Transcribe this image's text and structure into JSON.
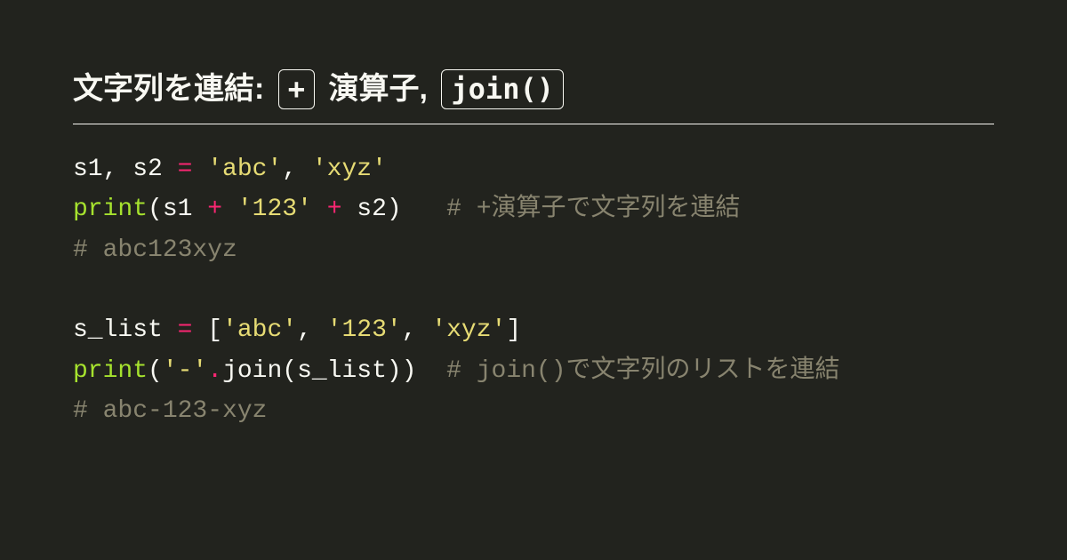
{
  "title": {
    "seg1": "文字列を連結: ",
    "chip1": "+",
    "seg2": " 演算子, ",
    "chip2": "join()"
  },
  "code": {
    "l1": {
      "a": "s1, s2 ",
      "op": "=",
      "b": " ",
      "s1": "'abc'",
      "c": ", ",
      "s2": "'xyz'"
    },
    "l2": {
      "fn": "print",
      "a": "(s1 ",
      "op1": "+",
      "b": " ",
      "s3": "'123'",
      "c": " ",
      "op2": "+",
      "d": " s2)   ",
      "cm": "# +演算子で文字列を連結"
    },
    "l3": {
      "cm": "# abc123xyz"
    },
    "l4": {
      "blank": ""
    },
    "l5": {
      "a": "s_list ",
      "op": "=",
      "b": " [",
      "s1": "'abc'",
      "c": ", ",
      "s2": "'123'",
      "d": ", ",
      "s3": "'xyz'",
      "e": "]"
    },
    "l6": {
      "fn": "print",
      "a": "(",
      "s1": "'-'",
      "dot": ".",
      "m": "join(s_list))  ",
      "cm": "# join()で文字列のリストを連結"
    },
    "l7": {
      "cm": "# abc-123-xyz"
    }
  }
}
